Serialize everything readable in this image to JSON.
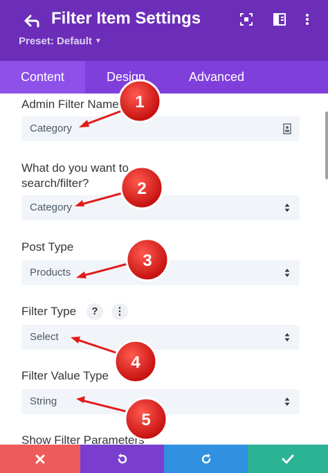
{
  "header": {
    "title": "Filter Item Settings",
    "preset_label": "Preset: Default",
    "icons": [
      "back-arrow-icon",
      "focus-icon",
      "split-view-icon",
      "more-vertical-icon"
    ]
  },
  "tabs": [
    {
      "label": "Content",
      "active": true
    },
    {
      "label": "Design",
      "active": false
    },
    {
      "label": "Advanced",
      "active": false
    }
  ],
  "fields": {
    "admin_filter_name": {
      "label": "Admin Filter Name",
      "value": "Category"
    },
    "search_filter": {
      "label": "What do you want to search/filter?",
      "value": "Category"
    },
    "post_type": {
      "label": "Post Type",
      "value": "Products"
    },
    "filter_type": {
      "label": "Filter Type",
      "value": "Select",
      "help_glyph": "?",
      "more_glyph": "⋮"
    },
    "filter_value_type": {
      "label": "Filter Value Type",
      "value": "String"
    },
    "show_filter_parameters": {
      "label": "Show Filter Parameters"
    }
  },
  "annotations": [
    "1",
    "2",
    "3",
    "4",
    "5"
  ],
  "footer": {
    "buttons": [
      "close-icon",
      "undo-icon",
      "redo-icon",
      "check-icon"
    ],
    "colors": [
      "#ef5b5b",
      "#7a3ecf",
      "#2f91e0",
      "#2bb394"
    ]
  },
  "colors": {
    "header": "#6c2eb9",
    "tabs": "#7f3fdb",
    "tab_active": "#8d51ea",
    "field_bg": "#f1f5f9",
    "annotation_red": "#e21b1b"
  }
}
